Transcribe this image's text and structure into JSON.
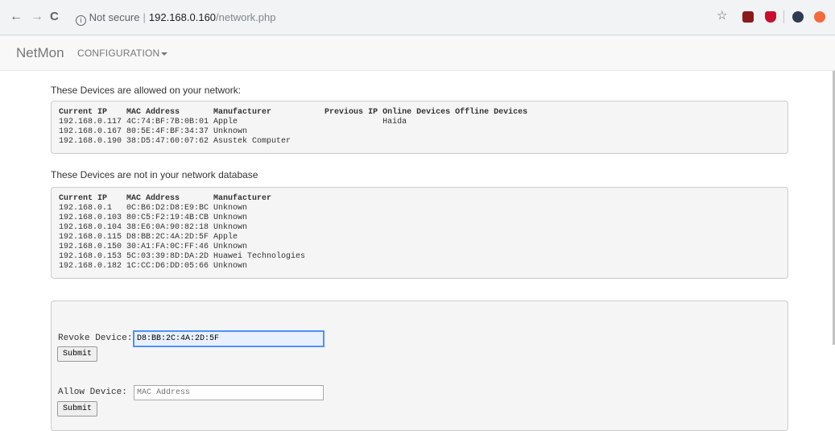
{
  "browser": {
    "back": "←",
    "forward": "→",
    "reload": "C",
    "security_label": "Not secure",
    "url_host": "192.168.0.160",
    "url_path": "/network.php",
    "star": "☆"
  },
  "navbar": {
    "brand": "NetMon",
    "menu_label": "CONFIGURATION"
  },
  "allowed": {
    "heading": "These Devices are allowed on your network:",
    "columns": [
      "Current IP",
      "MAC Address",
      "Manufacturer",
      "Previous IP",
      "Online Devices",
      "Offline Devices"
    ],
    "rows": [
      [
        "192.168.0.117",
        "4C:74:BF:7B:0B:01",
        "Apple",
        "",
        "Haida",
        ""
      ],
      [
        "192.168.0.167",
        "80:5E:4F:BF:34:37",
        "Unknown",
        "",
        "",
        ""
      ],
      [
        "192.168.0.190",
        "38:D5:47:60:07:62",
        "Asustek Computer",
        "",
        "",
        ""
      ]
    ]
  },
  "unknown": {
    "heading": "These Devices are not in your network database",
    "columns": [
      "Current IP",
      "MAC Address",
      "Manufacturer"
    ],
    "rows": [
      [
        "192.168.0.1",
        "0C:B6:D2:D8:E9:BC",
        "Unknown"
      ],
      [
        "192.168.0.103",
        "80:C5:F2:19:4B:CB",
        "Unknown"
      ],
      [
        "192.168.0.104",
        "38:E6:0A:90:82:18",
        "Unknown"
      ],
      [
        "192.168.0.115",
        "D8:BB:2C:4A:2D:5F",
        "Apple"
      ],
      [
        "192.168.0.150",
        "30:A1:FA:0C:FF:46",
        "Unknown"
      ],
      [
        "192.168.0.153",
        "5C:03:39:8D:DA:2D",
        "Huawei Technologies"
      ],
      [
        "192.168.0.182",
        "1C:CC:D6:DD:05:66",
        "Unknown"
      ]
    ]
  },
  "forms": {
    "revoke_label": "Revoke Device:",
    "revoke_value": "D8:BB:2C:4A:2D:5F",
    "allow_label": "Allow Device:",
    "allow_placeholder": "MAC Address",
    "submit_label": "Submit"
  },
  "colors": {
    "toolbar": "#f1f3f4",
    "navbar": "#f8f8f8",
    "well": "#f5f5f5",
    "input_focus": "#e8f0fe"
  }
}
